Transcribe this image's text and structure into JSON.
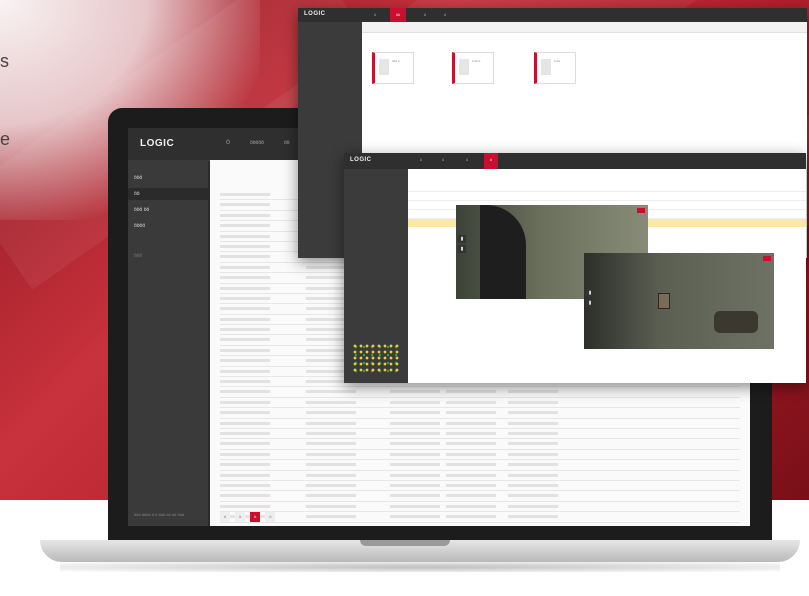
{
  "hero": {
    "line1": "s",
    "line2": "e"
  },
  "laptop_app": {
    "logo": "LOGIC",
    "nav": [
      "Ӧ",
      "ӧӧӧӧӧ",
      "ӧӧ"
    ],
    "sidebar": {
      "items": [
        "ӧӧӧ",
        "ӧӧ",
        "ӧӧӧ ӧӧ",
        "ӧӧӧӧ",
        "ӧӧӧ"
      ],
      "footer": "ӧӧӧ ӧӧӧӧ ӧ ӧ ӧӧӧ ӧӧ ӧӧ ӧӧӧ"
    },
    "table_rows": 45,
    "pager": [
      "ӧ",
      "ӧ",
      "ӧ",
      "ӧ"
    ]
  },
  "window_devices": {
    "logo": "LOGIC",
    "tabs": [
      "ӧ",
      "ӧӧ",
      "ӧ",
      "ӧ"
    ],
    "cards": [
      {
        "t": "ӧӧӧ ӧ"
      },
      {
        "t": "ӧ ӧӧ ӧ"
      },
      {
        "t": "ӧ ӧӧ"
      }
    ]
  },
  "window_cameras": {
    "logo": "LOGIC",
    "tabs": [
      "ӧ",
      "ӧ",
      "ӧ",
      "ӧ"
    ]
  },
  "colors": {
    "accent": "#c8102e"
  }
}
